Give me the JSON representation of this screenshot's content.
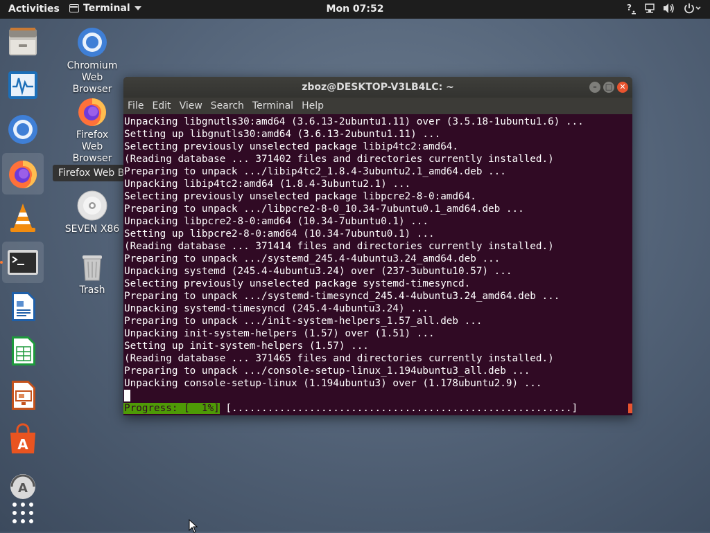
{
  "topbar": {
    "activities": "Activities",
    "app_name": "Terminal",
    "clock": "Mon 07:52",
    "tray_icons": [
      "accessibility-icon",
      "network-icon",
      "volume-icon",
      "power-icon"
    ]
  },
  "dock": {
    "items": [
      {
        "name": "Files",
        "icon": "files-icon"
      },
      {
        "name": "System Monitor",
        "icon": "system-monitor-icon"
      },
      {
        "name": "Chromium",
        "icon": "chromium-icon"
      },
      {
        "name": "Firefox Web Browser",
        "icon": "firefox-icon"
      },
      {
        "name": "VLC",
        "icon": "vlc-icon"
      },
      {
        "name": "Terminal",
        "icon": "terminal-icon"
      },
      {
        "name": "LibreOffice Writer",
        "icon": "writer-icon"
      },
      {
        "name": "LibreOffice Calc",
        "icon": "calc-icon"
      },
      {
        "name": "LibreOffice Impress",
        "icon": "impress-icon"
      },
      {
        "name": "Ubuntu Software",
        "icon": "software-icon"
      },
      {
        "name": "Software Updater",
        "icon": "updater-icon"
      },
      {
        "name": "Show Applications",
        "icon": "app-grid-icon"
      }
    ],
    "tooltip": "Firefox Web Browser"
  },
  "desktop": {
    "icons": [
      {
        "label_lines": [
          "Chromium",
          "Web",
          "Browser"
        ],
        "icon": "chromium-icon"
      },
      {
        "label_lines": [
          "Firefox",
          "Web",
          "Browser"
        ],
        "icon": "firefox-icon"
      },
      {
        "label_lines": [
          "SEVEN X86"
        ],
        "icon": "disc-icon"
      },
      {
        "label_lines": [
          "Trash"
        ],
        "icon": "trash-icon"
      }
    ]
  },
  "terminal": {
    "title": "zboz@DESKTOP-V3LB4LC: ~",
    "menu": [
      "File",
      "Edit",
      "View",
      "Search",
      "Terminal",
      "Help"
    ],
    "lines": [
      "Unpacking libgnutls30:amd64 (3.6.13-2ubuntu1.11) over (3.5.18-1ubuntu1.6) ...",
      "Setting up libgnutls30:amd64 (3.6.13-2ubuntu1.11) ...",
      "Selecting previously unselected package libip4tc2:amd64.",
      "(Reading database ... 371402 files and directories currently installed.)",
      "Preparing to unpack .../libip4tc2_1.8.4-3ubuntu2.1_amd64.deb ...",
      "Unpacking libip4tc2:amd64 (1.8.4-3ubuntu2.1) ...",
      "Selecting previously unselected package libpcre2-8-0:amd64.",
      "Preparing to unpack .../libpcre2-8-0_10.34-7ubuntu0.1_amd64.deb ...",
      "Unpacking libpcre2-8-0:amd64 (10.34-7ubuntu0.1) ...",
      "Setting up libpcre2-8-0:amd64 (10.34-7ubuntu0.1) ...",
      "(Reading database ... 371414 files and directories currently installed.)",
      "Preparing to unpack .../systemd_245.4-4ubuntu3.24_amd64.deb ...",
      "Unpacking systemd (245.4-4ubuntu3.24) over (237-3ubuntu10.57) ...",
      "Selecting previously unselected package systemd-timesyncd.",
      "Preparing to unpack .../systemd-timesyncd_245.4-4ubuntu3.24_amd64.deb ...",
      "Unpacking systemd-timesyncd (245.4-4ubuntu3.24) ...",
      "Preparing to unpack .../init-system-helpers_1.57_all.deb ...",
      "Unpacking init-system-helpers (1.57) over (1.51) ...",
      "Setting up init-system-helpers (1.57) ...",
      "(Reading database ... 371465 files and directories currently installed.)",
      "Preparing to unpack .../console-setup-linux_1.194ubuntu3_all.deb ...",
      "Unpacking console-setup-linux (1.194ubuntu3) over (1.178ubuntu2.9) ..."
    ],
    "progress_label": "Progress: [  1%]",
    "progress_bar": " [.........................................................] ",
    "progress_percent": 1
  },
  "colors": {
    "terminal_bg": "#300a24",
    "progress_green": "#4e9a06",
    "accent_orange": "#e9542f"
  }
}
